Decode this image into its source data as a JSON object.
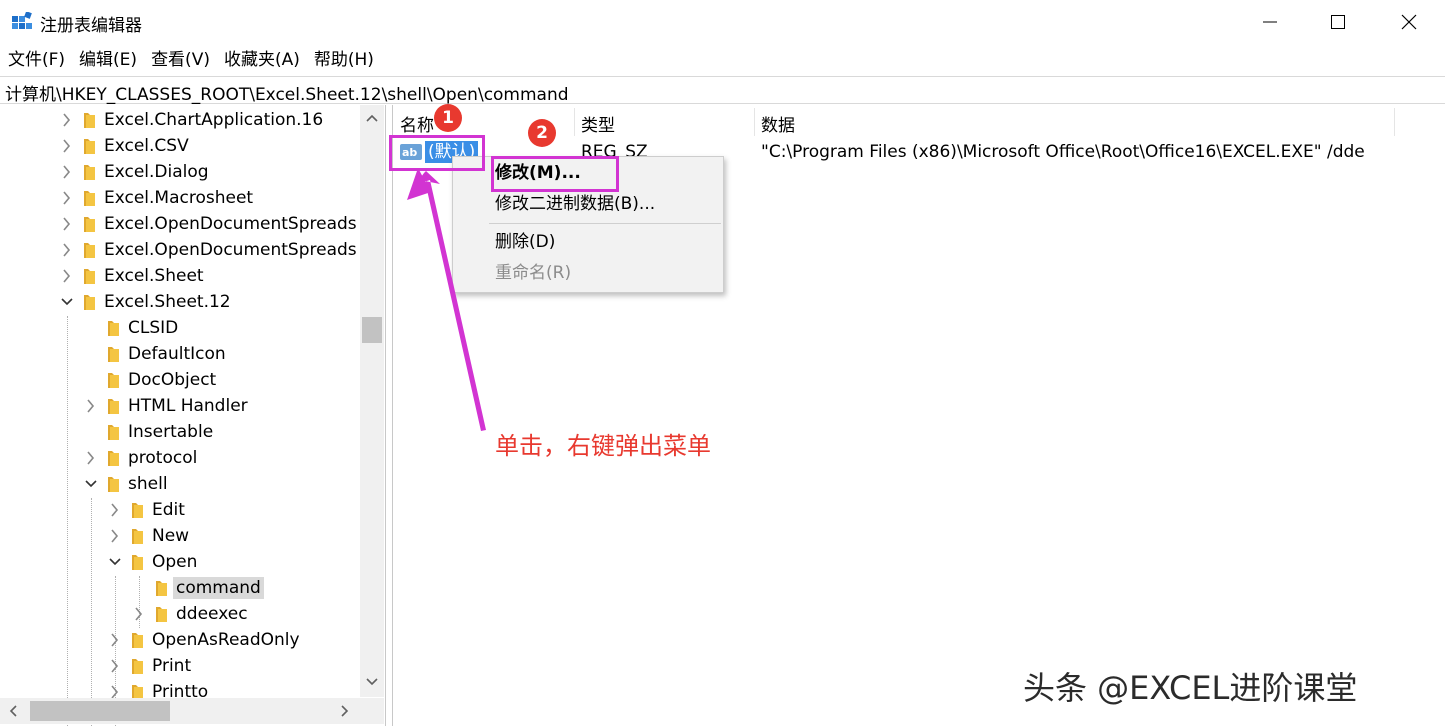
{
  "window": {
    "title": "注册表编辑器",
    "controls": {
      "minimize": "minimize-icon",
      "maximize": "maximize-icon",
      "close": "close-icon"
    }
  },
  "menu": [
    "文件(F)",
    "编辑(E)",
    "查看(V)",
    "收藏夹(A)",
    "帮助(H)"
  ],
  "address": "计算机\\HKEY_CLASSES_ROOT\\Excel.Sheet.12\\shell\\Open\\command",
  "tree": [
    {
      "label": "Excel.ChartApplication.16",
      "expander": "collapsed"
    },
    {
      "label": "Excel.CSV",
      "expander": "collapsed"
    },
    {
      "label": "Excel.Dialog",
      "expander": "collapsed"
    },
    {
      "label": "Excel.Macrosheet",
      "expander": "collapsed"
    },
    {
      "label": "Excel.OpenDocumentSpreads",
      "expander": "collapsed"
    },
    {
      "label": "Excel.OpenDocumentSpreads",
      "expander": "collapsed"
    },
    {
      "label": "Excel.Sheet",
      "expander": "collapsed"
    },
    {
      "label": "Excel.Sheet.12",
      "expander": "expanded"
    },
    {
      "label": "CLSID",
      "expander": "none"
    },
    {
      "label": "DefaultIcon",
      "expander": "none"
    },
    {
      "label": "DocObject",
      "expander": "none"
    },
    {
      "label": "HTML Handler",
      "expander": "collapsed"
    },
    {
      "label": "Insertable",
      "expander": "none"
    },
    {
      "label": "protocol",
      "expander": "collapsed"
    },
    {
      "label": "shell",
      "expander": "expanded"
    },
    {
      "label": "Edit",
      "expander": "collapsed"
    },
    {
      "label": "New",
      "expander": "collapsed"
    },
    {
      "label": "Open",
      "expander": "expanded"
    },
    {
      "label": "command",
      "expander": "none",
      "selected": true
    },
    {
      "label": "ddeexec",
      "expander": "collapsed"
    },
    {
      "label": "OpenAsReadOnly",
      "expander": "collapsed"
    },
    {
      "label": "Print",
      "expander": "collapsed"
    },
    {
      "label": "Printto",
      "expander": "collapsed"
    }
  ],
  "columns": {
    "name": "名称",
    "type": "类型",
    "data": "数据"
  },
  "values": [
    {
      "name": "(默认)",
      "type": "REG_SZ",
      "data": "\"C:\\Program Files (x86)\\Microsoft Office\\Root\\Office16\\EXCEL.EXE\" /dde"
    }
  ],
  "context_menu": {
    "modify": "修改(M)...",
    "modify_binary": "修改二进制数据(B)...",
    "delete": "删除(D)",
    "rename": "重命名(R)"
  },
  "annotations": {
    "badge1": "1",
    "badge2": "2",
    "note": "单击，右键弹出菜单",
    "watermark": "头条 @EXCEL进阶课堂",
    "highlight_color": "#d234d2",
    "badge_color": "#e8392f"
  },
  "colors": {
    "folder": "#f4c542",
    "selection": "#3a8ee6",
    "tree_selected": "#d9d9d9"
  }
}
